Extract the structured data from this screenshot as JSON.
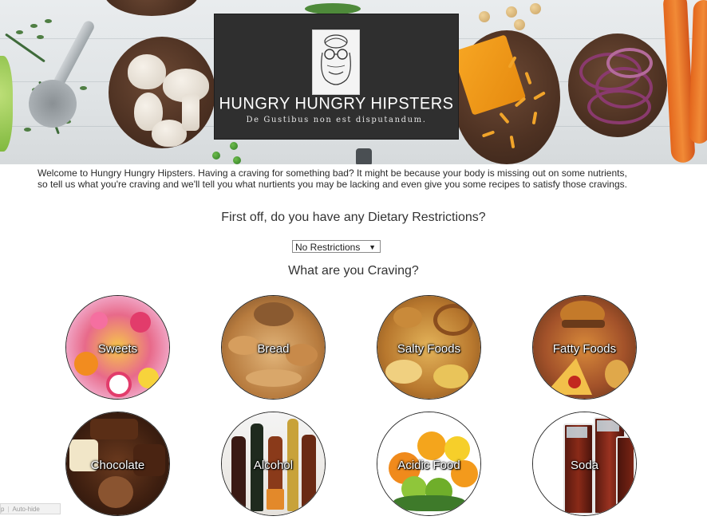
{
  "brand": {
    "title": "HUNGRY HUNGRY HIPSTERS",
    "tagline": "De Gustibus non est disputandum."
  },
  "intro": {
    "line1": "Welcome to Hungry Hungry Hipsters. Having a craving for something bad? It might be because your body is missing out on some nutrients,",
    "line2": "so tell us what you're craving and we'll tell you what nurtients you may be lacking and even give you some recipes to satisfy those cravings."
  },
  "dietary": {
    "question": "First off, do you have any Dietary Restrictions?",
    "selected": "No Restrictions"
  },
  "craving": {
    "question": "What are you Craving?",
    "items": [
      {
        "label": "Sweets"
      },
      {
        "label": "Bread"
      },
      {
        "label": "Salty Foods"
      },
      {
        "label": "Fatty Foods"
      },
      {
        "label": "Chocolate"
      },
      {
        "label": "Alcohol"
      },
      {
        "label": "Acidic Food"
      },
      {
        "label": "Soda"
      }
    ]
  },
  "toolbar": {
    "left": "p",
    "autohide": "Auto-hide"
  }
}
